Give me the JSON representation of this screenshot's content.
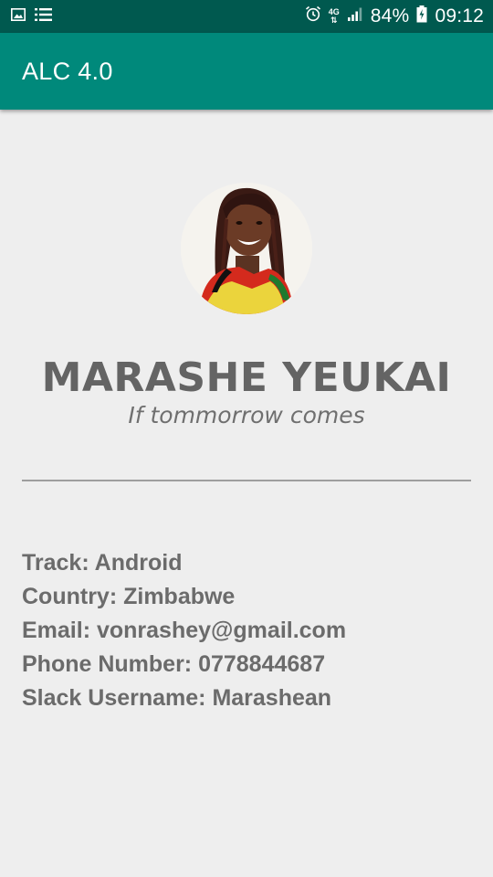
{
  "status_bar": {
    "network_type": "4G",
    "battery_percent": "84%",
    "time": "09:12",
    "icons": [
      "image-icon",
      "list-icon",
      "alarm-icon",
      "network-arrows-icon",
      "signal-icon",
      "battery-icon"
    ]
  },
  "app_bar": {
    "title": "ALC 4.0",
    "color": "#00897b"
  },
  "profile": {
    "avatar": "profile-photo",
    "name": "MARASHE YEUKAI",
    "tagline": "If tommorrow comes"
  },
  "details": [
    {
      "label": "Track",
      "value": "Android",
      "text": "Track: Android"
    },
    {
      "label": "Country",
      "value": "Zimbabwe",
      "text": "Country: Zimbabwe"
    },
    {
      "label": "Email",
      "value": "vonrashey@gmail.com",
      "text": "Email: vonrashey@gmail.com"
    },
    {
      "label": "Phone Number",
      "value": "0778844687",
      "text": "Phone Number: 0778844687"
    },
    {
      "label": "Slack Username",
      "value": "Marashean",
      "text": "Slack Username: Marashean"
    }
  ],
  "colors": {
    "status_bar": "#00594f",
    "app_bar": "#00897b",
    "background": "#eeeeee",
    "text": "#666666"
  }
}
